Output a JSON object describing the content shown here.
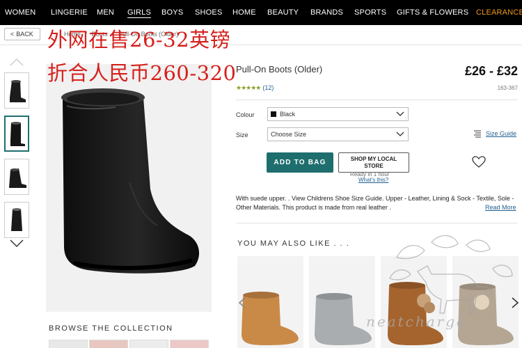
{
  "nav": {
    "items": [
      "WOMEN",
      "LINGERIE",
      "MEN",
      "GIRLS",
      "BOYS",
      "SHOES",
      "HOME",
      "BEAUTY",
      "BRANDS",
      "SPORTS",
      "GIFTS & FLOWERS",
      "CLEARANCE"
    ],
    "active": "GIRLS"
  },
  "back_label": "BACK",
  "breadcrumb": [
    "Home",
    "/",
    "Boots",
    "/",
    "Pull-On Boots (Older)"
  ],
  "overlay": {
    "line1": "外网在售26-32英镑",
    "line2": "折合人民币260-320"
  },
  "product": {
    "title": "Pull-On Boots (Older)",
    "price": "£26 - £32",
    "code": "163-367",
    "rating_stars": "★★★★★",
    "rating_count": "(12)",
    "colour_label": "Colour",
    "colour_value": "Black",
    "size_label": "Size",
    "size_placeholder": "Choose Size",
    "size_guide": "Size Guide",
    "add_to_bag": "ADD TO BAG",
    "shop_local_line1": "SHOP MY LOCAL",
    "shop_local_line2": "STORE",
    "ready_text": "Ready in 1 hour",
    "whats_this": "What's this?",
    "description": "With suede upper. . View Childrens Shoe Size Guide. Upper - Leather, Lining & Sock - Textile, Sole - Other Materials. This product is made from real leather .",
    "read_more": "Read More"
  },
  "browse_title": "BROWSE THE COLLECTION",
  "may_also_like": "YOU MAY ALSO LIKE . . .",
  "watermark": "neatcharge",
  "colors": {
    "accent": "#1f6e6e",
    "clearance": "#f39a1e",
    "link": "#1f5e8f",
    "overlay_red": "#d6201c"
  }
}
